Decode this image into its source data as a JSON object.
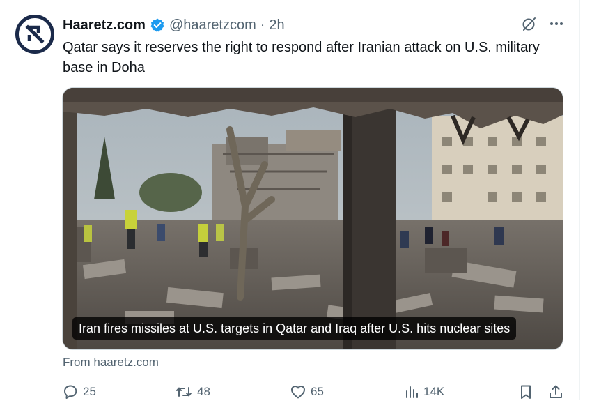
{
  "tweet": {
    "display_name": "Haaretz.com",
    "handle": "@haaretzcom",
    "separator": "·",
    "time": "2h",
    "text": "Qatar says it reserves the right to respond after Iranian attack on U.S. military base in Doha",
    "avatar_icon": "haaretz-logo-icon",
    "verified_icon": "verified-badge-icon",
    "verified_color": "#1d9bf0"
  },
  "card": {
    "caption": "Iran fires missiles at U.S. targets in Qatar and Iraq after U.S. hits nuclear sites",
    "source": "From haaretz.com"
  },
  "actions": {
    "replies": "25",
    "reposts": "48",
    "likes": "65",
    "views": "14K"
  },
  "icons": {
    "grok": "grok-icon",
    "more": "more-icon",
    "reply": "reply-icon",
    "repost": "repost-icon",
    "like": "heart-icon",
    "views": "views-icon",
    "bookmark": "bookmark-icon",
    "share": "share-icon"
  },
  "colors": {
    "text_primary": "#0f1419",
    "text_secondary": "#536471",
    "brand_avatar": "#1b2a4a",
    "border": "#cfd9de"
  }
}
